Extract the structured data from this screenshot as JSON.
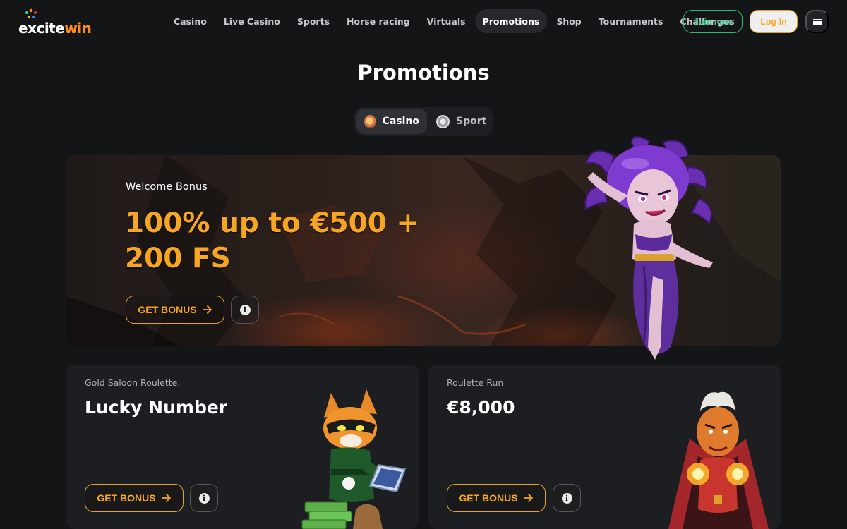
{
  "brand": {
    "logo_main": "excite",
    "logo_accent": "win"
  },
  "nav": {
    "items": [
      {
        "label": "Casino",
        "active": false
      },
      {
        "label": "Live Casino",
        "active": false
      },
      {
        "label": "Sports",
        "active": false
      },
      {
        "label": "Horse racing",
        "active": false
      },
      {
        "label": "Virtuals",
        "active": false
      },
      {
        "label": "Promotions",
        "active": true
      },
      {
        "label": "Shop",
        "active": false
      },
      {
        "label": "Tournaments",
        "active": false
      },
      {
        "label": "Challenges",
        "active": false
      }
    ],
    "join_label": "Join now",
    "login_label": "Log In",
    "menu_icon": "hamburger-icon"
  },
  "page": {
    "title": "Promotions"
  },
  "toggle": {
    "options": [
      {
        "label": "Casino",
        "icon": "roulette-icon",
        "active": true
      },
      {
        "label": "Sport",
        "icon": "football-icon",
        "active": false
      }
    ]
  },
  "hero": {
    "label": "Welcome Bonus",
    "amount_line1": "100% up to €500 +",
    "amount_line2": "200 FS",
    "cta_label": "GET BONUS",
    "info_icon": "info-icon"
  },
  "cards": [
    {
      "subtitle": "Gold Saloon Roulette:",
      "title": "Lucky Number",
      "cta_label": "GET BONUS",
      "info_icon": "info-icon"
    },
    {
      "subtitle": "Roulette Run",
      "title": "€8,000",
      "cta_label": "GET BONUS",
      "info_icon": "info-icon"
    }
  ],
  "colors": {
    "accent": "#f6a623",
    "join": "#3fd28f",
    "background": "#141517",
    "card": "#1c1e21"
  }
}
